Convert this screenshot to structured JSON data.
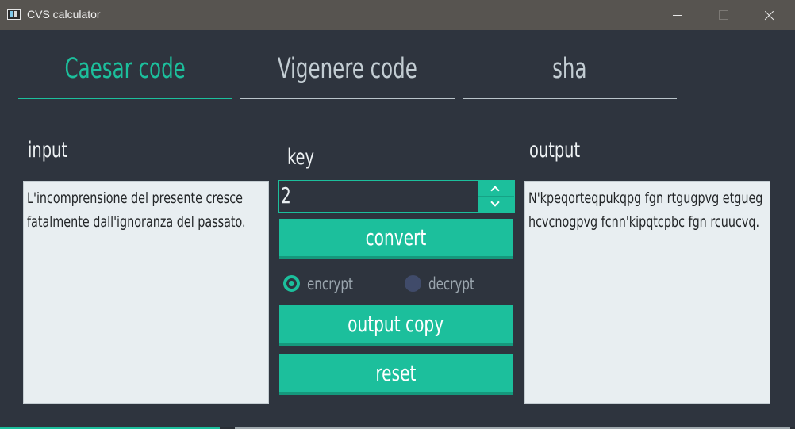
{
  "window": {
    "title": "CVS calculator",
    "icons": {
      "app": "app-window-icon",
      "minimize": "minimize-icon",
      "maximize": "maximize-icon",
      "close": "close-icon"
    }
  },
  "tabs": [
    {
      "label": "Caesar code",
      "active": true
    },
    {
      "label": "Vigenere code",
      "active": false
    },
    {
      "label": "sha",
      "active": false
    }
  ],
  "input": {
    "label": "input",
    "value": "L'incomprensione del presente cresce fatalmente dall'ignoranza del passato."
  },
  "key": {
    "label": "key",
    "value": "2"
  },
  "output": {
    "label": "output",
    "value": "N'kpeqorteqpukqpg fgn rtgugpvg etgueg hcvcnogpvg fcnn'kipqtcpbc fgn rcuucvq."
  },
  "buttons": {
    "convert": "convert",
    "output_copy": "output copy",
    "reset": "reset"
  },
  "mode": {
    "encrypt_label": "encrypt",
    "decrypt_label": "decrypt",
    "selected": "encrypt"
  },
  "colors": {
    "accent": "#1cbf9c",
    "background": "#2e343e",
    "titlebar": "#575450",
    "textbox": "#e8eef1"
  }
}
